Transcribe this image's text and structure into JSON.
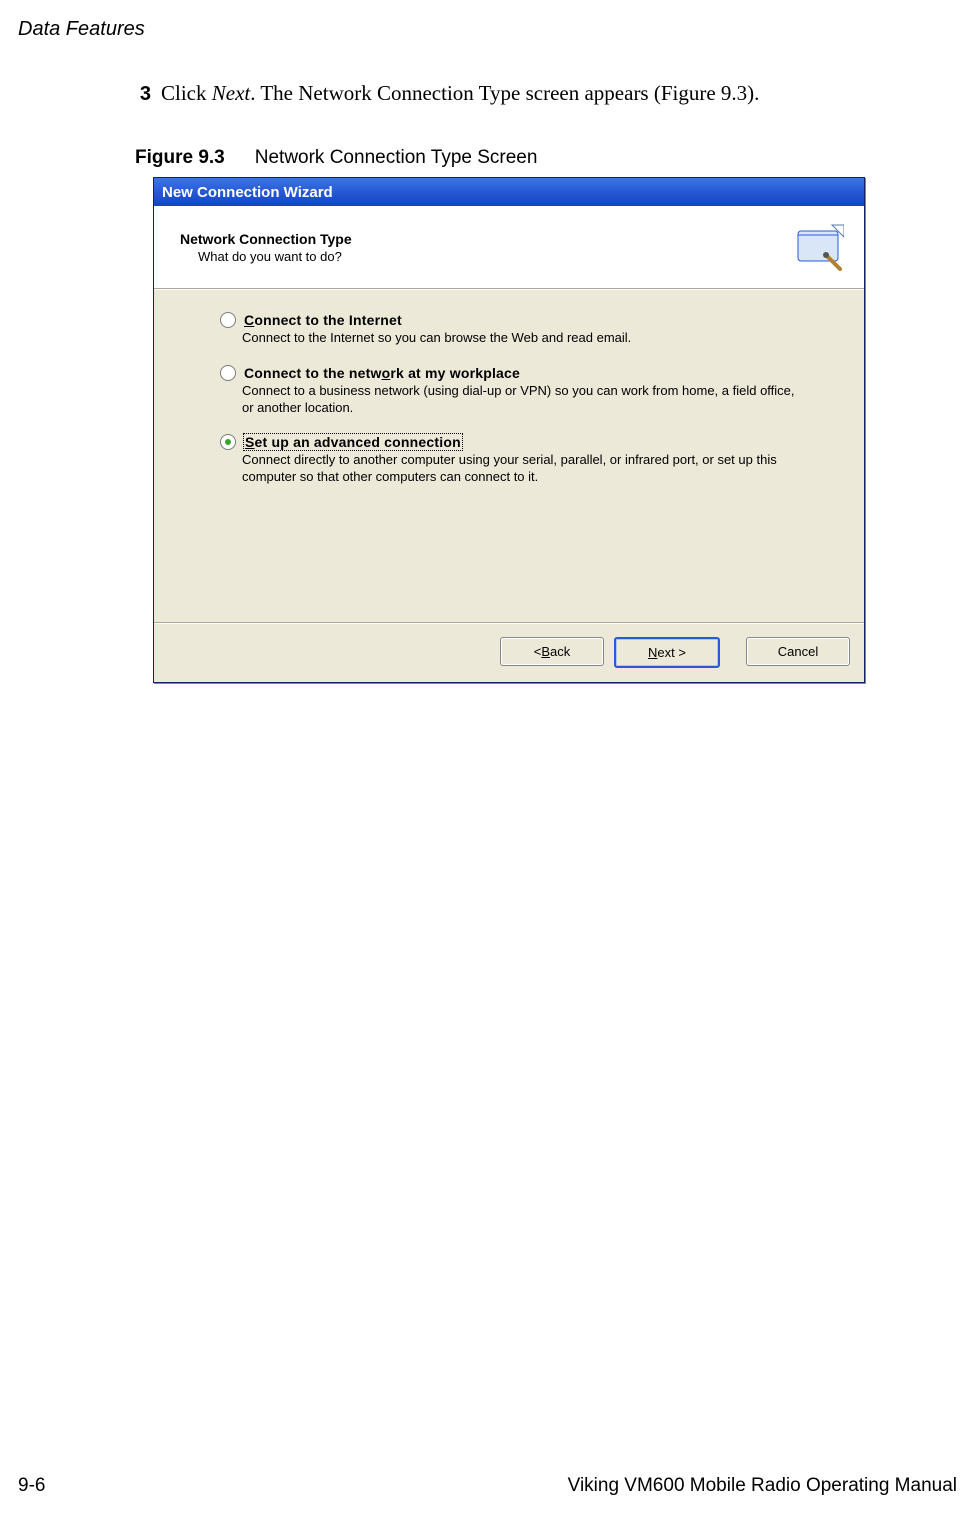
{
  "section_header": "Data Features",
  "step": {
    "number": "3",
    "prefix": "Click ",
    "italic": "Next",
    "suffix": ". The Network Connection Type screen appears (Figure 9.3)."
  },
  "figure": {
    "label": "Figure 9.3",
    "caption": "Network Connection Type Screen"
  },
  "wizard": {
    "titlebar": "New Connection Wizard",
    "header_title": "Network Connection Type",
    "header_sub": "What do you want to do?",
    "options": [
      {
        "hotkey": "C",
        "rest": "onnect to the Internet",
        "desc": "Connect to the Internet so you can browse the Web and read email.",
        "checked": false,
        "focused": false
      },
      {
        "hotkey": "o",
        "pre": "Connect to the netw",
        "rest": "rk at my workplace",
        "desc": "Connect to a business network (using dial-up or VPN) so you can work from home, a field office, or another location.",
        "checked": false,
        "focused": false
      },
      {
        "hotkey": "S",
        "rest": "et up an advanced connection",
        "desc": "Connect directly to another computer using your serial, parallel, or infrared port, or set up this computer so that other computers can connect to it.",
        "checked": true,
        "focused": true
      }
    ],
    "buttons": {
      "back_pre": "< ",
      "back_hot": "B",
      "back_post": "ack",
      "next_hot": "N",
      "next_post": "ext >",
      "cancel": "Cancel"
    }
  },
  "footer": {
    "left": "9-6",
    "right": "Viking VM600 Mobile Radio Operating Manual"
  }
}
